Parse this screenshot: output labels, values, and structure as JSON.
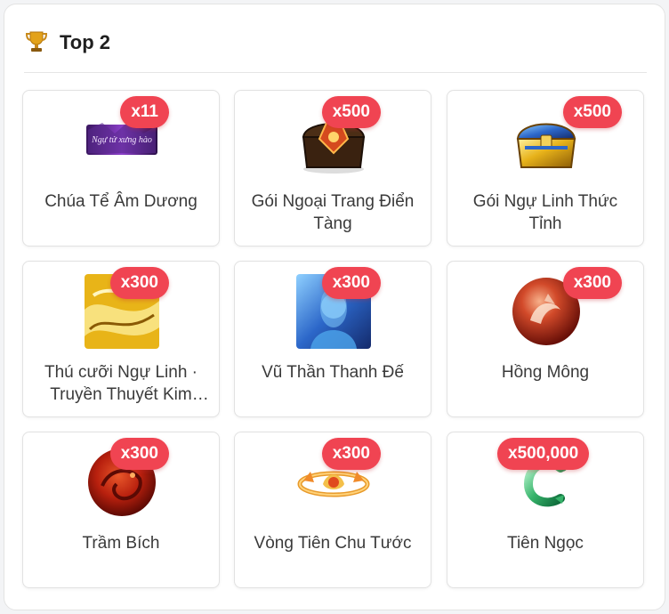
{
  "header": {
    "title": "Top 2",
    "icon": "trophy-icon"
  },
  "accent_color": "#f04452",
  "items": [
    {
      "name": "Chúa Tể Âm Dương",
      "quantity": "x11",
      "icon": "title-banner-icon"
    },
    {
      "name": "Gói Ngoại Trang Điển Tàng",
      "quantity": "x500",
      "icon": "treasure-chest-dark-icon"
    },
    {
      "name": "Gói Ngự Linh Thức Tỉnh",
      "quantity": "x500",
      "icon": "treasure-chest-gold-icon"
    },
    {
      "name": "Thú cưỡi Ngự Linh · Truyền Thuyết Kim Long",
      "quantity": "x300",
      "icon": "golden-dragon-mount-icon"
    },
    {
      "name": "Vũ Thần Thanh Đế",
      "quantity": "x300",
      "icon": "character-portrait-icon"
    },
    {
      "name": "Hồng Mông",
      "quantity": "x300",
      "icon": "red-orb-icon"
    },
    {
      "name": "Trầm Bích",
      "quantity": "x300",
      "icon": "red-dragon-orb-icon"
    },
    {
      "name": "Vòng Tiên Chu Tước",
      "quantity": "x300",
      "icon": "phoenix-ring-icon"
    },
    {
      "name": "Tiên Ngọc",
      "quantity": "x500,000",
      "icon": "jade-serpent-icon"
    }
  ]
}
